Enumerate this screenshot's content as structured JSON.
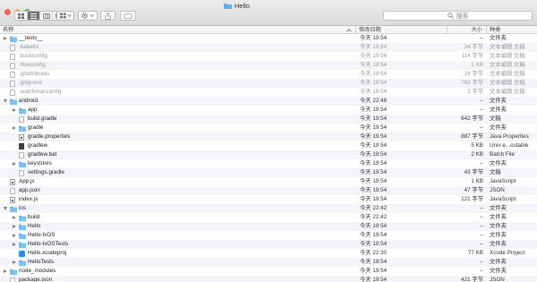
{
  "window": {
    "title": "Hello",
    "search_placeholder": "搜索"
  },
  "columns": {
    "name": "名称",
    "date": "修改日期",
    "size": "大小",
    "kind": "种类"
  },
  "rows": [
    {
      "name": "__tests__",
      "date": "今天 19:54",
      "size": "--",
      "kind": "文件夹",
      "type": "folder",
      "level": 0,
      "disclosure": "collapsed",
      "dim": false
    },
    {
      "name": ".babelrc",
      "date": "今天 19:54",
      "size": "34 字节",
      "kind": "文本编辑 文稿",
      "type": "file",
      "level": 0,
      "disclosure": "none",
      "dim": true
    },
    {
      "name": ".buckconfig",
      "date": "今天 19:54",
      "size": "114 字节",
      "kind": "文本编辑 文稿",
      "type": "file",
      "level": 0,
      "disclosure": "none",
      "dim": true
    },
    {
      "name": ".flowconfig",
      "date": "今天 19:54",
      "size": "1 KB",
      "kind": "文本编辑 文稿",
      "type": "file",
      "level": 0,
      "disclosure": "none",
      "dim": true
    },
    {
      "name": ".gitattributes",
      "date": "今天 19:54",
      "size": "16 字节",
      "kind": "文本编辑 文稿",
      "type": "file",
      "level": 0,
      "disclosure": "none",
      "dim": true
    },
    {
      "name": ".gitignore",
      "date": "今天 19:54",
      "size": "763 字节",
      "kind": "文本编辑 文稿",
      "type": "file",
      "level": 0,
      "disclosure": "none",
      "dim": true
    },
    {
      "name": ".watchmanconfig",
      "date": "今天 19:54",
      "size": "2 字节",
      "kind": "文本编辑 文稿",
      "type": "file",
      "level": 0,
      "disclosure": "none",
      "dim": true
    },
    {
      "name": "android",
      "date": "今天 22:46",
      "size": "--",
      "kind": "文件夹",
      "type": "folder",
      "level": 0,
      "disclosure": "expanded",
      "dim": false
    },
    {
      "name": "app",
      "date": "今天 19:54",
      "size": "--",
      "kind": "文件夹",
      "type": "folder",
      "level": 1,
      "disclosure": "collapsed",
      "dim": false
    },
    {
      "name": "build.gradle",
      "date": "今天 19:54",
      "size": "642 字节",
      "kind": "文稿",
      "type": "file",
      "level": 1,
      "disclosure": "none",
      "dim": false
    },
    {
      "name": "gradle",
      "date": "今天 19:54",
      "size": "--",
      "kind": "文件夹",
      "type": "folder",
      "level": 1,
      "disclosure": "collapsed",
      "dim": false
    },
    {
      "name": "gradle.properties",
      "date": "今天 19:54",
      "size": "887 字节",
      "kind": "Java Properties",
      "type": "code",
      "level": 1,
      "disclosure": "none",
      "dim": false
    },
    {
      "name": "gradlew",
      "date": "今天 19:54",
      "size": "5 KB",
      "kind": "Unix e...cutable",
      "type": "exec",
      "level": 1,
      "disclosure": "none",
      "dim": false
    },
    {
      "name": "gradlew.bat",
      "date": "今天 19:54",
      "size": "2 KB",
      "kind": "Batch File",
      "type": "file",
      "level": 1,
      "disclosure": "none",
      "dim": false
    },
    {
      "name": "keystores",
      "date": "今天 19:54",
      "size": "--",
      "kind": "文件夹",
      "type": "folder",
      "level": 1,
      "disclosure": "collapsed",
      "dim": false
    },
    {
      "name": "settings.gradle",
      "date": "今天 19:54",
      "size": "43 字节",
      "kind": "文稿",
      "type": "file",
      "level": 1,
      "disclosure": "none",
      "dim": false
    },
    {
      "name": "App.js",
      "date": "今天 19:54",
      "size": "1 KB",
      "kind": "JavaScript",
      "type": "code",
      "level": 0,
      "disclosure": "none",
      "dim": false
    },
    {
      "name": "app.json",
      "date": "今天 19:54",
      "size": "47 字节",
      "kind": "JSON",
      "type": "file",
      "level": 0,
      "disclosure": "none",
      "dim": false
    },
    {
      "name": "index.js",
      "date": "今天 19:54",
      "size": "121 字节",
      "kind": "JavaScript",
      "type": "code",
      "level": 0,
      "disclosure": "none",
      "dim": false
    },
    {
      "name": "ios",
      "date": "今天 22:42",
      "size": "--",
      "kind": "文件夹",
      "type": "folder",
      "level": 0,
      "disclosure": "expanded",
      "dim": false
    },
    {
      "name": "build",
      "date": "今天 22:42",
      "size": "--",
      "kind": "文件夹",
      "type": "folder",
      "level": 1,
      "disclosure": "collapsed",
      "dim": false
    },
    {
      "name": "Hello",
      "date": "今天 19:54",
      "size": "--",
      "kind": "文件夹",
      "type": "folder",
      "level": 1,
      "disclosure": "collapsed",
      "dim": false
    },
    {
      "name": "Hello-tvOS",
      "date": "今天 19:54",
      "size": "--",
      "kind": "文件夹",
      "type": "folder",
      "level": 1,
      "disclosure": "collapsed",
      "dim": false
    },
    {
      "name": "Hello-tvOSTests",
      "date": "今天 19:54",
      "size": "--",
      "kind": "文件夹",
      "type": "folder",
      "level": 1,
      "disclosure": "collapsed",
      "dim": false
    },
    {
      "name": "Hello.xcodeproj",
      "date": "今天 22:30",
      "size": "77 KB",
      "kind": "Xcode Project",
      "type": "xcode",
      "level": 1,
      "disclosure": "none",
      "dim": false
    },
    {
      "name": "HelloTests",
      "date": "今天 19:54",
      "size": "--",
      "kind": "文件夹",
      "type": "folder",
      "level": 1,
      "disclosure": "collapsed",
      "dim": false
    },
    {
      "name": "node_modules",
      "date": "今天 19:54",
      "size": "--",
      "kind": "文件夹",
      "type": "folder",
      "level": 0,
      "disclosure": "collapsed",
      "dim": false
    },
    {
      "name": "package.json",
      "date": "今天 19:54",
      "size": "421 字节",
      "kind": "JSON",
      "type": "file",
      "level": 0,
      "disclosure": "none",
      "dim": false
    }
  ]
}
